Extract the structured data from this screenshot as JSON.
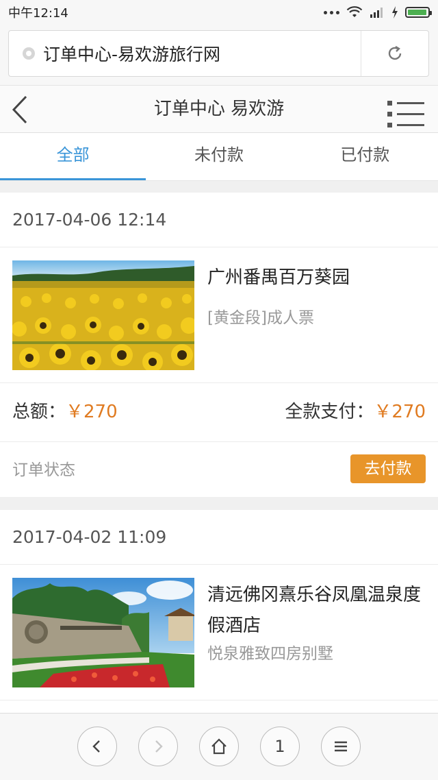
{
  "status_bar": {
    "time": "中午12:14"
  },
  "browser": {
    "url_title": "订单中心-易欢游旅行网",
    "tab_count": "1"
  },
  "header": {
    "title": "订单中心 易欢游"
  },
  "tabs": [
    {
      "label": "全部",
      "active": true
    },
    {
      "label": "未付款",
      "active": false
    },
    {
      "label": "已付款",
      "active": false
    }
  ],
  "orders": [
    {
      "date": "2017-04-06 12:14",
      "product_name": "广州番禺百万葵园",
      "spec": "[黄金段]成人票",
      "total_label": "总额：",
      "total_price": "￥270",
      "paid_label": "全款支付：",
      "paid_price": "￥270",
      "status_label": "订单状态",
      "action_label": "去付款"
    },
    {
      "date": "2017-04-02 11:09",
      "product_name": "清远佛冈熹乐谷凤凰温泉度假酒店",
      "spec": "悦泉雅致四房别墅"
    }
  ],
  "colors": {
    "accent": "#3a95d8",
    "price": "#e07b21",
    "pay_button": "#e8952a"
  }
}
